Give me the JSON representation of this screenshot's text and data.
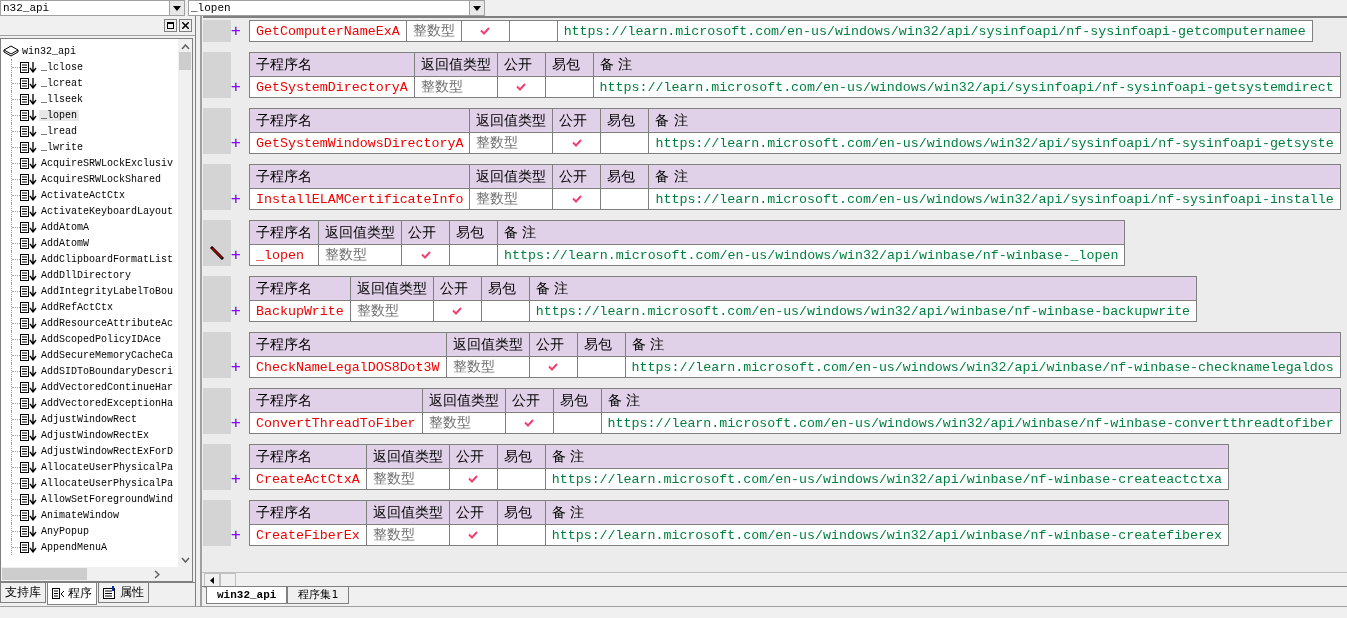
{
  "top_bar": {
    "library_combo": "n32_api",
    "item_combo": "_lopen"
  },
  "sidebar": {
    "tree": {
      "label": "win32_api",
      "children": [
        {
          "label": "_lclose",
          "selected": false
        },
        {
          "label": "_lcreat",
          "selected": false
        },
        {
          "label": "_llseek",
          "selected": false
        },
        {
          "label": "_lopen",
          "selected": true
        },
        {
          "label": "_lread",
          "selected": false
        },
        {
          "label": "_lwrite",
          "selected": false
        },
        {
          "label": "AcquireSRWLockExclusiv",
          "selected": false
        },
        {
          "label": "AcquireSRWLockShared",
          "selected": false
        },
        {
          "label": "ActivateActCtx",
          "selected": false
        },
        {
          "label": "ActivateKeyboardLayout",
          "selected": false
        },
        {
          "label": "AddAtomA",
          "selected": false
        },
        {
          "label": "AddAtomW",
          "selected": false
        },
        {
          "label": "AddClipboardFormatList",
          "selected": false
        },
        {
          "label": "AddDllDirectory",
          "selected": false
        },
        {
          "label": "AddIntegrityLabelToBou",
          "selected": false
        },
        {
          "label": "AddRefActCtx",
          "selected": false
        },
        {
          "label": "AddResourceAttributeAc",
          "selected": false
        },
        {
          "label": "AddScopedPolicyIDAce",
          "selected": false
        },
        {
          "label": "AddSecureMemoryCacheCa",
          "selected": false
        },
        {
          "label": "AddSIDToBoundaryDescri",
          "selected": false
        },
        {
          "label": "AddVectoredContinueHar",
          "selected": false
        },
        {
          "label": "AddVectoredExceptionHa",
          "selected": false
        },
        {
          "label": "AdjustWindowRect",
          "selected": false
        },
        {
          "label": "AdjustWindowRectEx",
          "selected": false
        },
        {
          "label": "AdjustWindowRectExForD",
          "selected": false
        },
        {
          "label": "AllocateUserPhysicalPa",
          "selected": false
        },
        {
          "label": "AllocateUserPhysicalPa",
          "selected": false
        },
        {
          "label": "AllowSetForegroundWind",
          "selected": false
        },
        {
          "label": "AnimateWindow",
          "selected": false
        },
        {
          "label": "AnyPopup",
          "selected": false
        },
        {
          "label": "AppendMenuA",
          "selected": false
        }
      ]
    },
    "tabs": [
      {
        "label": "支持库",
        "selected": false
      },
      {
        "label": "程序",
        "selected": true
      },
      {
        "label": "属性",
        "selected": false
      }
    ]
  },
  "editor": {
    "blocks": [
      {
        "editing": false,
        "expander": "+",
        "name": "GetComputerNameExA",
        "return_type": "整数型",
        "public": true,
        "note": "https://learn.microsoft.com/en-us/windows/win32/api/sysinfoapi/nf-sysinfoapi-getcomputernamee"
      },
      {
        "editing": false,
        "columns": [
          "子程序名",
          "返回值类型",
          "公开",
          "易包",
          "备 注"
        ],
        "expander": "+",
        "name": "GetSystemDirectoryA",
        "return_type": "整数型",
        "public": true,
        "note": "https://learn.microsoft.com/en-us/windows/win32/api/sysinfoapi/nf-sysinfoapi-getsystemdirect"
      },
      {
        "editing": false,
        "columns": [
          "子程序名",
          "返回值类型",
          "公开",
          "易包",
          "备 注"
        ],
        "expander": "+",
        "name": "GetSystemWindowsDirectoryA",
        "return_type": "整数型",
        "public": true,
        "note": "https://learn.microsoft.com/en-us/windows/win32/api/sysinfoapi/nf-sysinfoapi-getsyste"
      },
      {
        "editing": false,
        "columns": [
          "子程序名",
          "返回值类型",
          "公开",
          "易包",
          "备 注"
        ],
        "expander": "+",
        "name": "InstallELAMCertificateInfo",
        "return_type": "整数型",
        "public": true,
        "note": "https://learn.microsoft.com/en-us/windows/win32/api/sysinfoapi/nf-sysinfoapi-installe"
      },
      {
        "editing": true,
        "columns": [
          "子程序名",
          "返回值类型",
          "公开",
          "易包",
          "备 注"
        ],
        "expander": "+",
        "name": "_lopen",
        "return_type": "整数型",
        "public": true,
        "note": "https://learn.microsoft.com/en-us/windows/win32/api/winbase/nf-winbase-_lopen"
      },
      {
        "editing": false,
        "columns": [
          "子程序名",
          "返回值类型",
          "公开",
          "易包",
          "备 注"
        ],
        "expander": "+",
        "name": "BackupWrite",
        "return_type": "整数型",
        "public": true,
        "note": "https://learn.microsoft.com/en-us/windows/win32/api/winbase/nf-winbase-backupwrite"
      },
      {
        "editing": false,
        "columns": [
          "子程序名",
          "返回值类型",
          "公开",
          "易包",
          "备 注"
        ],
        "expander": "+",
        "name": "CheckNameLegalDOS8Dot3W",
        "return_type": "整数型",
        "public": true,
        "note": "https://learn.microsoft.com/en-us/windows/win32/api/winbase/nf-winbase-checknamelegaldos"
      },
      {
        "editing": false,
        "columns": [
          "子程序名",
          "返回值类型",
          "公开",
          "易包",
          "备 注"
        ],
        "expander": "+",
        "name": "ConvertThreadToFiber",
        "return_type": "整数型",
        "public": true,
        "note": "https://learn.microsoft.com/en-us/windows/win32/api/winbase/nf-winbase-convertthreadtofiber"
      },
      {
        "editing": false,
        "columns": [
          "子程序名",
          "返回值类型",
          "公开",
          "易包",
          "备 注"
        ],
        "expander": "+",
        "name": "CreateActCtxA",
        "return_type": "整数型",
        "public": true,
        "note": "https://learn.microsoft.com/en-us/windows/win32/api/winbase/nf-winbase-createactctxa"
      },
      {
        "editing": false,
        "columns": [
          "子程序名",
          "返回值类型",
          "公开",
          "易包",
          "备 注"
        ],
        "expander": "+",
        "name": "CreateFiberEx",
        "return_type": "整数型",
        "public": true,
        "note": "https://learn.microsoft.com/en-us/windows/win32/api/winbase/nf-winbase-createfiberex"
      }
    ]
  },
  "bottom_tabs": [
    {
      "label": "win32_api",
      "selected": true
    },
    {
      "label": "程序集1",
      "selected": false
    }
  ]
}
